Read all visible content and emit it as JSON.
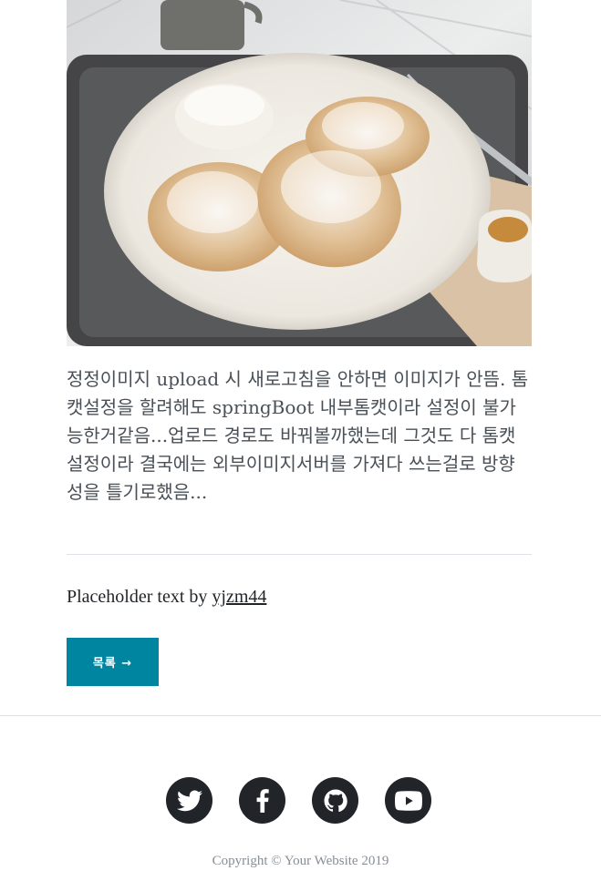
{
  "post": {
    "body": "정정이미지 upload 시 새로고침을 안하면 이미지가 안뜸. 톰캣설정을 할려해도 springBoot 내부톰캣이라 설정이 불가능한거같음...업로드 경로도 바꿔볼까했는데 그것도 다 톰캣설정이라 결국에는 외부이미지서버를 가져다 쓰는걸로 방향성을 틀기로했음...",
    "credit_prefix": "Placeholder text by ",
    "credit_author": "yjzm44",
    "list_button": "목록 →"
  },
  "footer": {
    "social": [
      "twitter-icon",
      "facebook-icon",
      "github-icon",
      "youtube-icon"
    ],
    "copyright": "Copyright © Your Website 2019"
  },
  "colors": {
    "accent": "#0085a1",
    "social_circle": "#212529",
    "body_text": "#495057",
    "muted_text": "#868e96"
  }
}
